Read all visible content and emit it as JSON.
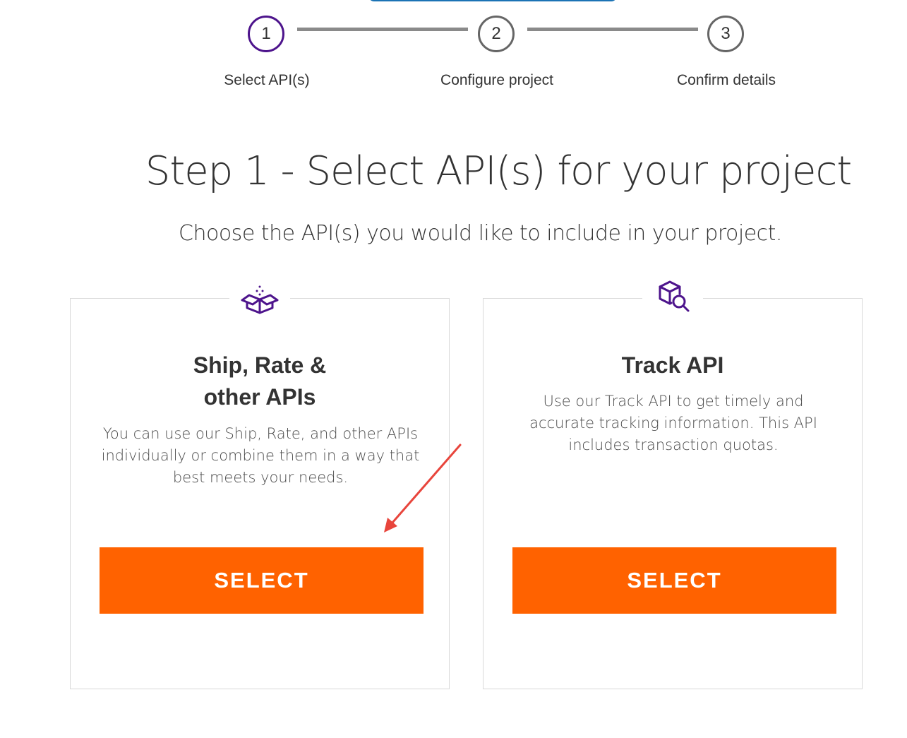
{
  "stepper": {
    "steps": [
      {
        "number": "1",
        "label": "Select API(s)"
      },
      {
        "number": "2",
        "label": "Configure project"
      },
      {
        "number": "3",
        "label": "Confirm details"
      }
    ]
  },
  "main": {
    "title": "Step 1 - Select API(s) for your project",
    "subtitle": "Choose the API(s) you would like to include in your project."
  },
  "cards": [
    {
      "icon": "open-box-icon",
      "title": "Ship, Rate &\nother APIs",
      "description": "You can use our Ship, Rate, and other APIs individually or combine them in a way that best meets your needs.",
      "button_label": "SELECT"
    },
    {
      "icon": "package-search-icon",
      "title": "Track API",
      "description": "Use our Track API to get timely and accurate tracking information. This API includes transaction quotas.",
      "button_label": "SELECT"
    }
  ],
  "colors": {
    "accent_purple": "#4d148c",
    "button_orange": "#ff6200",
    "annotation_red": "#e8453c",
    "top_bar_blue": "#1b73b5"
  }
}
